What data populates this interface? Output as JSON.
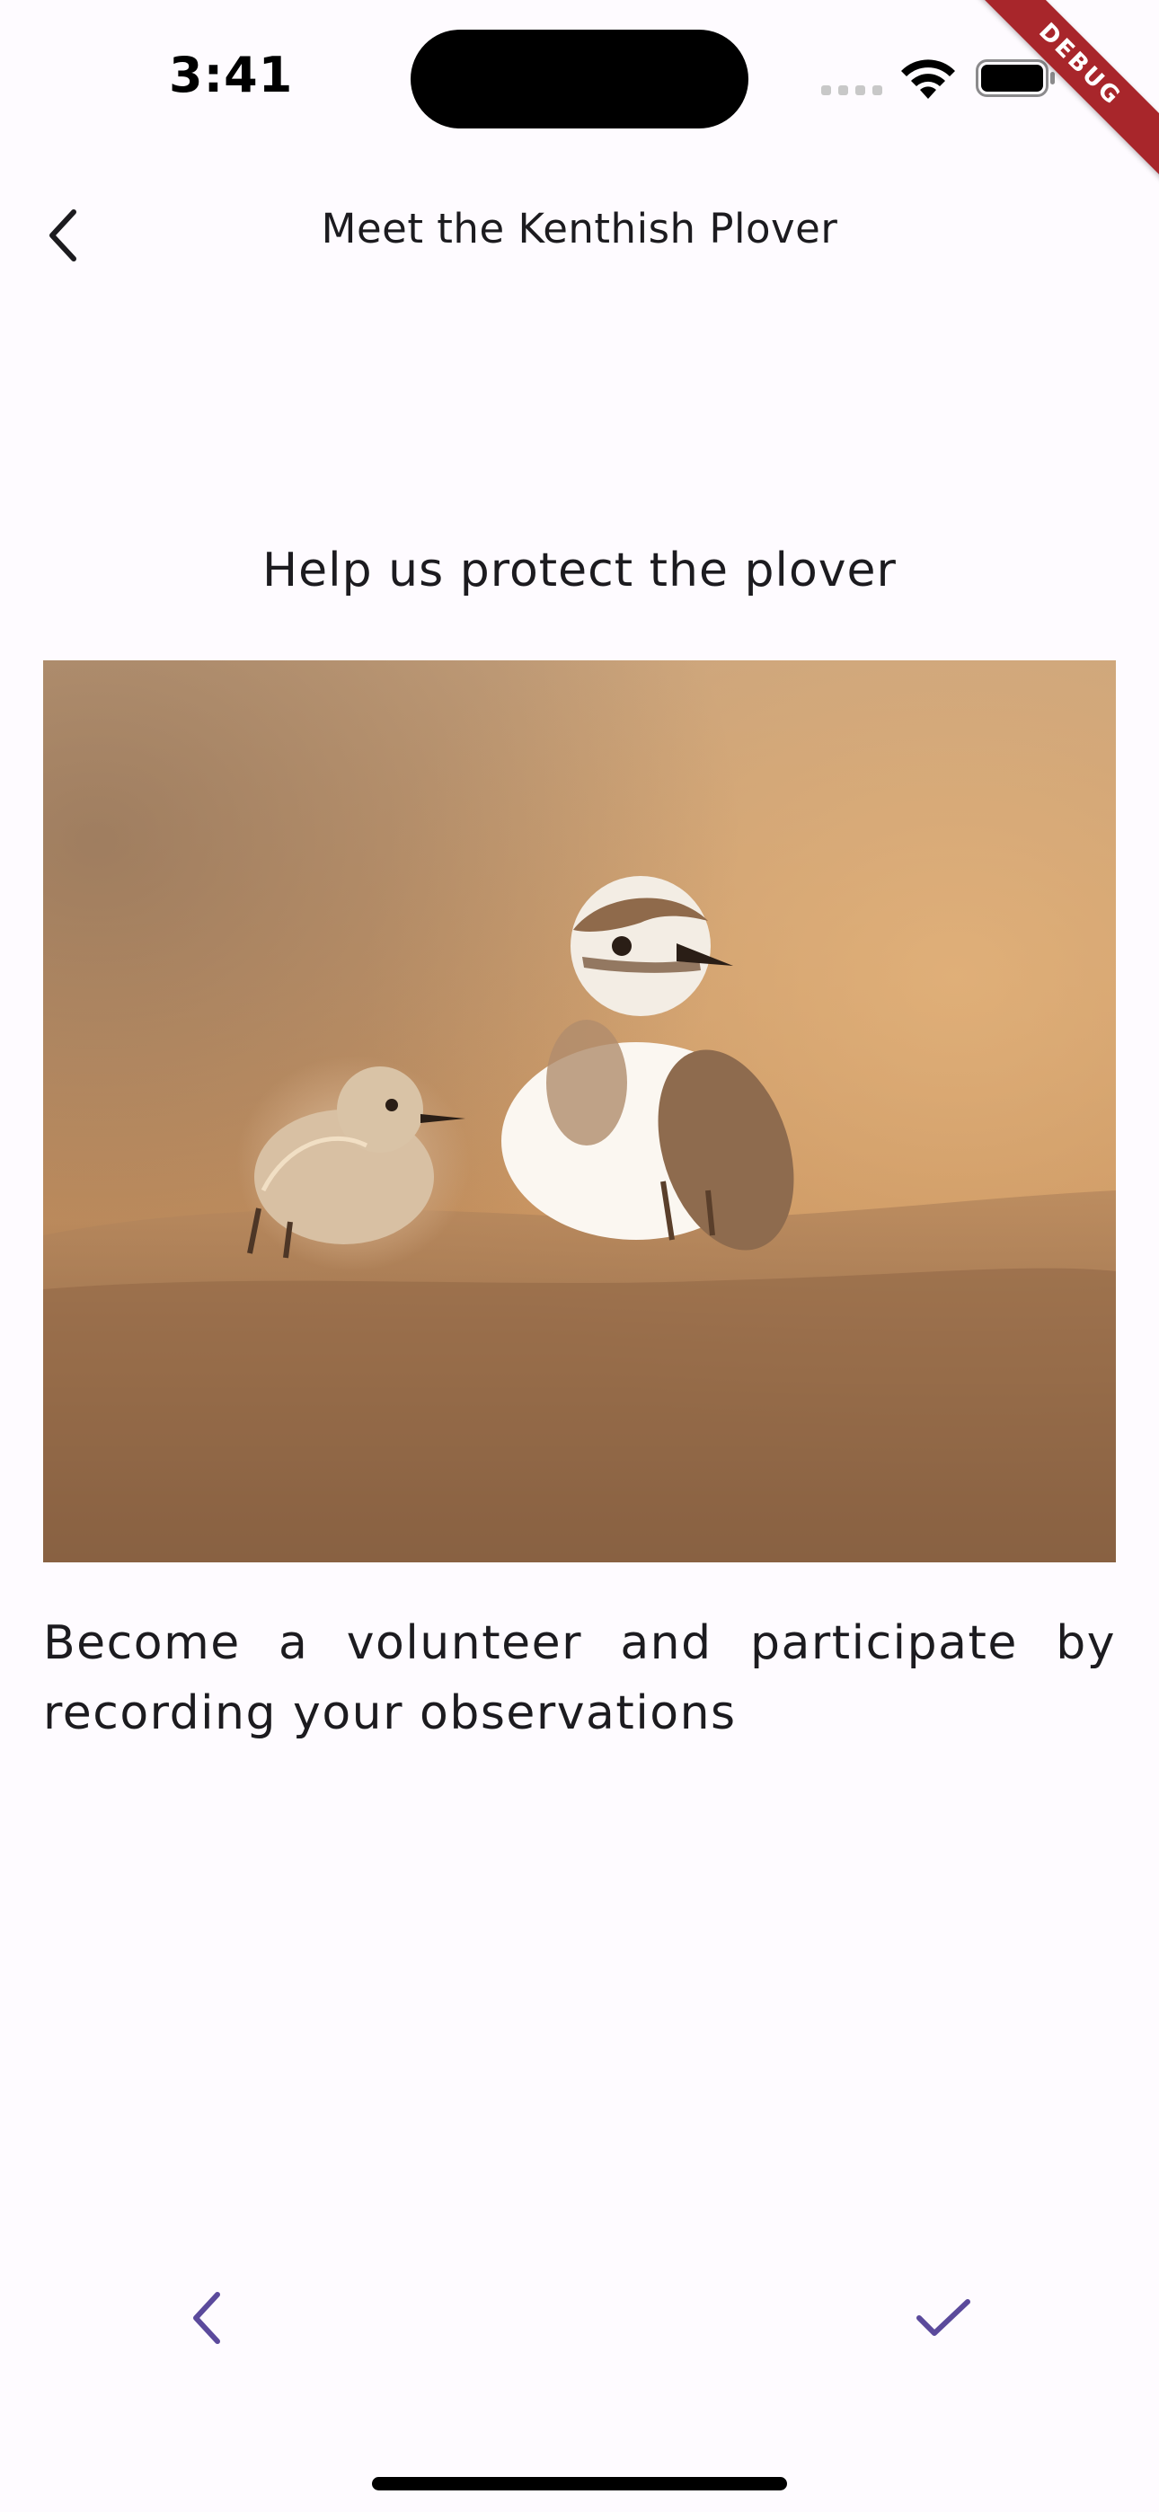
{
  "status_bar": {
    "time": "3:41"
  },
  "debug_banner": {
    "label": "DEBUG"
  },
  "app_bar": {
    "title": "Meet the Kenthish Plover",
    "back_icon": "chevron-left-icon"
  },
  "content": {
    "headline": "Help us protect the plover",
    "image_subject": "Kentish plover adult with chick on sand at sunset",
    "description": "Become a volunteer and participate by recording your observations"
  },
  "navigation": {
    "previous_icon": "chevron-left-icon",
    "done_icon": "check-icon"
  },
  "colors": {
    "accent": "#5b4a9c",
    "background": "#fefbff",
    "text": "#1c1b1f",
    "debug_banner": "#a8262b"
  }
}
